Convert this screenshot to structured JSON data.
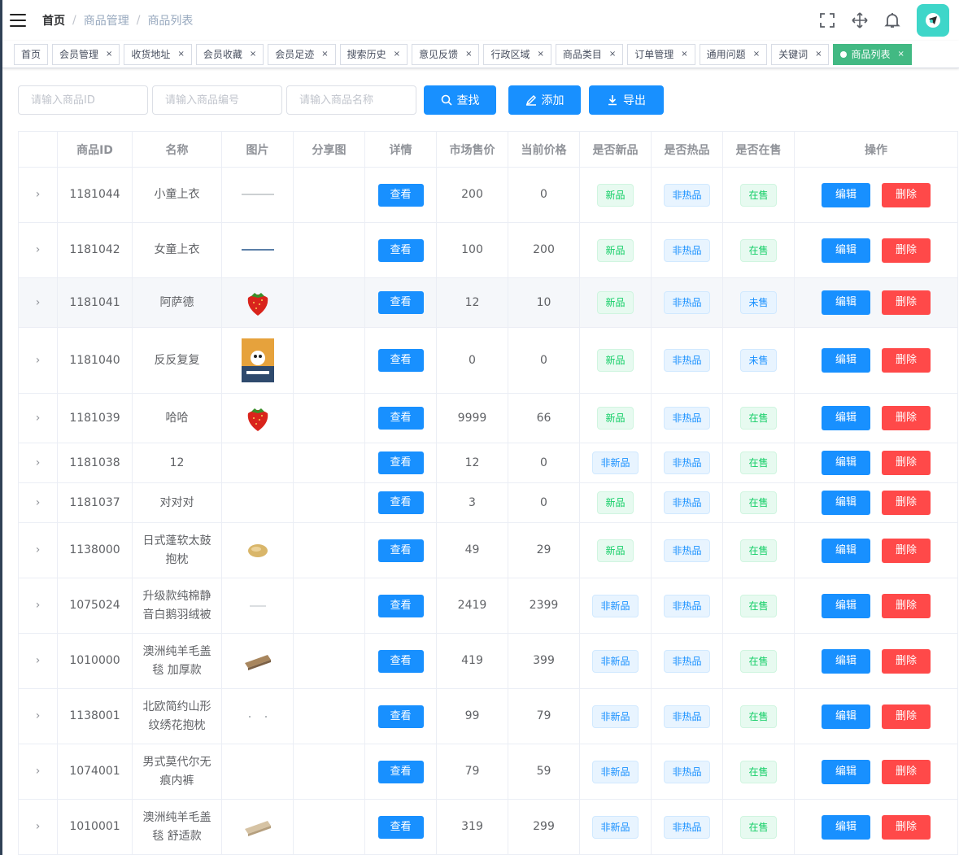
{
  "navbar": {
    "breadcrumb": [
      "首页",
      "商品管理",
      "商品列表"
    ],
    "icons": [
      "fullscreen-icon",
      "size-icon",
      "bell-icon",
      "avatar"
    ]
  },
  "tags": [
    {
      "label": "首页",
      "closable": false,
      "active": false
    },
    {
      "label": "会员管理",
      "closable": true,
      "active": false
    },
    {
      "label": "收货地址",
      "closable": true,
      "active": false
    },
    {
      "label": "会员收藏",
      "closable": true,
      "active": false
    },
    {
      "label": "会员足迹",
      "closable": true,
      "active": false
    },
    {
      "label": "搜索历史",
      "closable": true,
      "active": false
    },
    {
      "label": "意见反馈",
      "closable": true,
      "active": false
    },
    {
      "label": "行政区域",
      "closable": true,
      "active": false
    },
    {
      "label": "商品类目",
      "closable": true,
      "active": false
    },
    {
      "label": "订单管理",
      "closable": true,
      "active": false
    },
    {
      "label": "通用问题",
      "closable": true,
      "active": false
    },
    {
      "label": "关键词",
      "closable": true,
      "active": false
    },
    {
      "label": "商品列表",
      "closable": true,
      "active": true
    }
  ],
  "filter": {
    "goods_id_placeholder": "请输入商品ID",
    "goods_sn_placeholder": "请输入商品编号",
    "goods_name_placeholder": "请输入商品名称",
    "search_label": "查找",
    "add_label": "添加",
    "export_label": "导出"
  },
  "table": {
    "headers": [
      "",
      "商品ID",
      "名称",
      "图片",
      "分享图",
      "详情",
      "市场售价",
      "当前价格",
      "是否新品",
      "是否热品",
      "是否在售",
      "操作"
    ],
    "view_label": "查看",
    "edit_label": "编辑",
    "delete_label": "删除",
    "rows": [
      {
        "id": "1181044",
        "name": "小童上衣",
        "pic": "line",
        "counter": "200",
        "retail": "0",
        "is_new": "新品",
        "is_hot": "非热品",
        "on_sale": "在售"
      },
      {
        "id": "1181042",
        "name": "女童上衣",
        "pic": "line-blue",
        "counter": "100",
        "retail": "200",
        "is_new": "新品",
        "is_hot": "非热品",
        "on_sale": "在售"
      },
      {
        "id": "1181041",
        "name": "阿萨德",
        "pic": "strawberry",
        "counter": "12",
        "retail": "10",
        "is_new": "新品",
        "is_hot": "非热品",
        "on_sale": "未售"
      },
      {
        "id": "1181040",
        "name": "反反复复",
        "pic": "poster",
        "counter": "0",
        "retail": "0",
        "is_new": "新品",
        "is_hot": "非热品",
        "on_sale": "未售"
      },
      {
        "id": "1181039",
        "name": "哈哈",
        "pic": "strawberry",
        "counter": "9999",
        "retail": "66",
        "is_new": "新品",
        "is_hot": "非热品",
        "on_sale": "在售"
      },
      {
        "id": "1181038",
        "name": "12",
        "pic": "",
        "counter": "12",
        "retail": "0",
        "is_new": "非新品",
        "is_hot": "非热品",
        "on_sale": "在售"
      },
      {
        "id": "1181037",
        "name": "对对对",
        "pic": "",
        "counter": "3",
        "retail": "0",
        "is_new": "新品",
        "is_hot": "非热品",
        "on_sale": "在售"
      },
      {
        "id": "1138000",
        "name": "日式蓬软太鼓抱枕",
        "pic": "cushion",
        "counter": "49",
        "retail": "29",
        "is_new": "新品",
        "is_hot": "非热品",
        "on_sale": "在售"
      },
      {
        "id": "1075024",
        "name": "升级款纯棉静音白鹅羽绒被",
        "pic": "tiny",
        "counter": "2419",
        "retail": "2399",
        "is_new": "非新品",
        "is_hot": "非热品",
        "on_sale": "在售"
      },
      {
        "id": "1010000",
        "name": "澳洲纯羊毛盖毯 加厚款",
        "pic": "blanket",
        "counter": "419",
        "retail": "399",
        "is_new": "非新品",
        "is_hot": "非热品",
        "on_sale": "在售"
      },
      {
        "id": "1138001",
        "name": "北欧简约山形纹绣花抱枕",
        "pic": "dots",
        "counter": "99",
        "retail": "79",
        "is_new": "非新品",
        "is_hot": "非热品",
        "on_sale": "在售"
      },
      {
        "id": "1074001",
        "name": "男式莫代尔无痕内裤",
        "pic": "",
        "counter": "79",
        "retail": "59",
        "is_new": "非新品",
        "is_hot": "非热品",
        "on_sale": "在售"
      },
      {
        "id": "1010001",
        "name": "澳洲纯羊毛盖毯 舒适款",
        "pic": "blanket-light",
        "counter": "319",
        "retail": "299",
        "is_new": "非新品",
        "is_hot": "非热品",
        "on_sale": "在售"
      }
    ]
  },
  "colors": {
    "primary": "#1890ff",
    "danger": "#ff4949",
    "success": "#13ce66",
    "tag_active": "#42b983"
  }
}
